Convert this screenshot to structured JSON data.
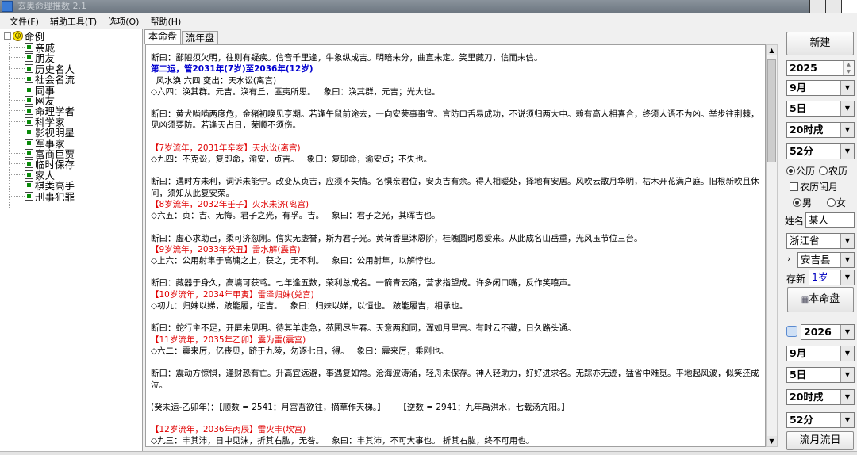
{
  "window": {
    "title": "玄奥命理推数 2.1"
  },
  "menu": [
    "文件(F)",
    "辅助工具(T)",
    "选项(O)",
    "帮助(H)"
  ],
  "tree": {
    "root": "命例",
    "items": [
      "亲戚",
      "朋友",
      "历史名人",
      "社会名流",
      "同事",
      "网友",
      "命理学者",
      "科学家",
      "影视明星",
      "军事家",
      "富商巨贾",
      "临时保存",
      "家人",
      "棋类高手",
      "刑事犯罪"
    ]
  },
  "tabs": [
    "本命盘",
    "流年盘"
  ],
  "content": [
    {
      "t": "断曰：鄙陋须欠明，往则有疑疾。信音千里逢，牛象纵成吉。明暗未分，曲直未定。笑里藏刀，信而未信。",
      "s": ""
    },
    {
      "t": "第二运，管2031年(7岁)至2036年(12岁)",
      "s": "blue"
    },
    {
      "t": "  风水涣 六四 变出：天水讼(离宫)",
      "s": ""
    },
    {
      "t": "◇六四：涣其群。元吉。涣有丘，匪夷所思。   象曰：涣其群，元吉；光大也。",
      "s": ""
    },
    {
      "t": "",
      "s": "gap"
    },
    {
      "t": "断曰：黄犬啮啮两度危，金猪初唤见亨期。若逢午鼠前途去，一向安荣事事宜。言防口舌易成功，不说须归两大中。赖有高人相喜合，终须人语不为凶。举步往荆棘，见凶须要防。若逢天占日，荣顺不须伤。",
      "s": ""
    },
    {
      "t": "",
      "s": "gap"
    },
    {
      "t": "【7岁流年，2031年辛亥】天水讼(离宫)",
      "s": "red"
    },
    {
      "t": "◇九四：不克讼，复即命，渝安，贞吉。   象曰：复即命，渝安贞；不失也。",
      "s": ""
    },
    {
      "t": "",
      "s": "gap"
    },
    {
      "t": "断曰：遇时方未利，词诉未能宁。改变从贞吉，应须不失情。名惧亲君位，安贞吉有余。得人相暖处，择地有安居。风吹云散月华明，枯木开花满户庭。旧根新吹且休问，须知从此复安荣。",
      "s": ""
    },
    {
      "t": "【8岁流年，2032年壬子】火水未济(离宫)",
      "s": "red"
    },
    {
      "t": "◇六五：贞：吉、无悔。君子之光，有孚。吉。   象曰：君子之光，其晖吉也。",
      "s": ""
    },
    {
      "t": "",
      "s": "gap"
    },
    {
      "t": "断曰：虚心求助己，柔可济忽刚。信实无虚誉，斯为君子光。黄荷香里沐恩阶，桂魄圆时恩爱来。从此成名山岳重，光风玉节位三台。",
      "s": ""
    },
    {
      "t": "【9岁流年，2033年癸丑】雷水解(震宫)",
      "s": "red"
    },
    {
      "t": "◇上六：公用射隼于高墉之上，获之，无不利。   象曰：公用射隼，以解悖也。",
      "s": ""
    },
    {
      "t": "",
      "s": "gap"
    },
    {
      "t": "断曰：藏器于身久，高墉可获鸢。七年逢五数，荣利总成名。一箭青云路，营求指望成。许多闲口嘴，反作笑嘻声。",
      "s": ""
    },
    {
      "t": "【10岁流年，2034年甲寅】雷泽归妹(兑宫)",
      "s": "red"
    },
    {
      "t": "◇初九：归妹以娣，跛能履，征吉。   象曰：归妹以娣，以恒也。 跛能履吉，相承也。",
      "s": ""
    },
    {
      "t": "",
      "s": "gap"
    },
    {
      "t": "断曰：蛇行主不足，开屏未见明。待其羊走急，苑圃尽生春。天意两和同，浑如月里宫。有时云不藏，日久路头通。",
      "s": ""
    },
    {
      "t": "【11岁流年，2035年乙卯】震为雷(震宫)",
      "s": "red"
    },
    {
      "t": "◇六二：震来厉，亿丧贝，跻于九陵，勿逐七日，得。   象曰：震来厉，乘刚也。",
      "s": ""
    },
    {
      "t": "",
      "s": "gap"
    },
    {
      "t": "断曰：震动方惊惧，逢财恐有亡。升高宜远避，事遇复如常。沧海波涛涌，轻舟未保存。神人轻助力，好好进求名。无踪亦无迹，猛省中难觅。平地起风波，似笑还成泣。",
      "s": ""
    },
    {
      "t": "",
      "s": "gap"
    },
    {
      "t": "(癸未运-乙卯年)：【顺数 = 2541：月宫吾欲往，摘草作天梯。】     【逆数 = 2941：九年禹洪水，七载汤亢阳。】",
      "s": ""
    },
    {
      "t": "",
      "s": "gap"
    },
    {
      "t": "【12岁流年，2036年丙辰】雷火丰(坎宫)",
      "s": "red"
    },
    {
      "t": "◇九三：丰其沛，日中见沫，折其右肱，无咎。   象曰：丰其沛，不可大事也。 折其右肱，终不可用也。",
      "s": ""
    }
  ],
  "right": {
    "new_btn": "新建",
    "year": "2025",
    "month": "9月",
    "day": "5日",
    "hour": "20时戌",
    "minute": "52分",
    "cal_gong": "公历",
    "cal_nong": "农历",
    "leap": "农历闰月",
    "male": "男",
    "female": "女",
    "name_label": "姓名",
    "name_value": "某人",
    "province": "浙江省",
    "county": "安吉县",
    "save_label": "存新",
    "save_value": "1岁",
    "bming_btn": "本命盘",
    "year2": "2026",
    "month2": "9月",
    "day2": "5日",
    "hour2": "20时戌",
    "minute2": "52分",
    "liuyue_btn": "流月流日"
  }
}
